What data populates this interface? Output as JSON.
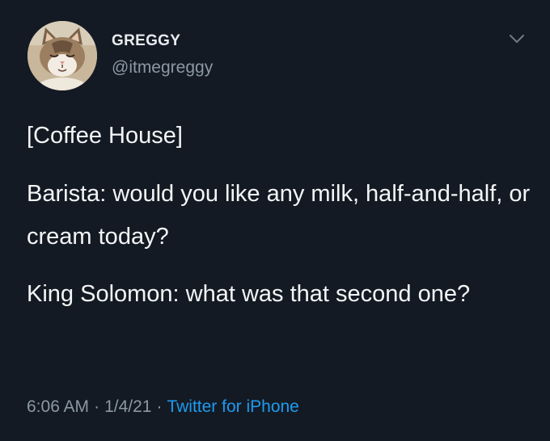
{
  "author": {
    "name": "GREGGY",
    "handle": "@itmegreggy"
  },
  "tweet": {
    "paragraphs": [
      "[Coffee House]",
      "Barista: would you like any milk, half-and-half, or cream today?",
      "King Solomon: what was that second one?"
    ]
  },
  "meta": {
    "time": "6:06 AM",
    "separator": "·",
    "date": "1/4/21",
    "source": "Twitter for iPhone"
  },
  "colors": {
    "background": "#141a23",
    "link": "#1d9bf0",
    "secondary_text": "#8b98a5"
  },
  "icons": {
    "menu": "chevron-down-icon",
    "avatar": "cat-photo"
  }
}
